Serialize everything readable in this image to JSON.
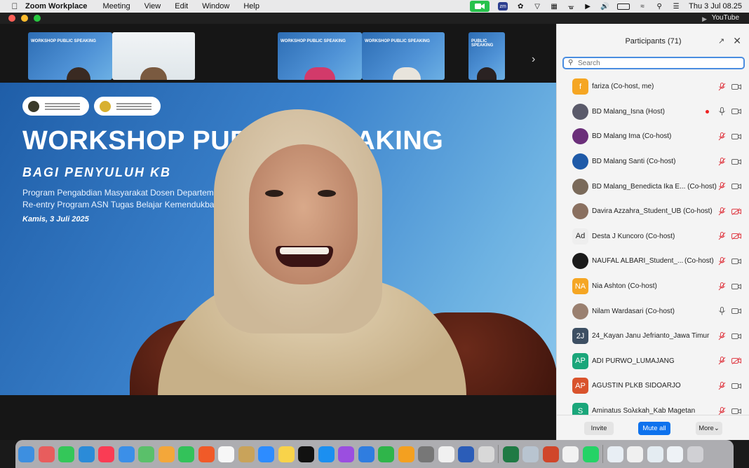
{
  "menubar": {
    "app_name": "Zoom Workplace",
    "items": [
      "Meeting",
      "View",
      "Edit",
      "Window",
      "Help"
    ],
    "zm_badge": "zm",
    "clock": "Thu 3 Jul  08.25"
  },
  "titlebar": {
    "right_label": "YouTube"
  },
  "thumbnails": {
    "slide_text": "WORKSHOP PUBLIC SPEAKING",
    "slide_text_short": "PUBLIC SPEAKING",
    "next_icon": "chevron-right-icon"
  },
  "slide": {
    "title": "WORKSHOP PUBLIC SPEAKING",
    "subtitle": "BAGI PENYULUH KB",
    "line1": "Program Pengabdian Masyarakat Dosen Departemen",
    "line2": "Re-entry Program ASN Tugas Belajar Kemendukbang",
    "date": "Kamis, 3 Juli 2025"
  },
  "participants": {
    "title": "Participants (71)",
    "search_placeholder": "Search",
    "list": [
      {
        "name": "fariza (Co-host, me)",
        "initials": "f",
        "color": "#f5a623",
        "mic": "muted",
        "cam": "on"
      },
      {
        "name": "BD Malang_Isna (Host)",
        "initials": "",
        "color": "#5a5a6a",
        "mic": "on",
        "cam": "on",
        "recording": true
      },
      {
        "name": "BD Malang Ima (Co-host)",
        "initials": "",
        "color": "#6b2f7a",
        "mic": "muted",
        "cam": "on"
      },
      {
        "name": "BD Malang Santi (Co-host)",
        "initials": "",
        "color": "#1e5aa8",
        "mic": "muted",
        "cam": "on"
      },
      {
        "name": "BD Malang_Benedicta Ika E... (Co-host)",
        "initials": "",
        "color": "#7a6a5a",
        "mic": "muted",
        "cam": "on"
      },
      {
        "name": "Davira Azzahra_Student_UB (Co-host)",
        "initials": "",
        "color": "#8a7060",
        "mic": "muted",
        "cam": "off"
      },
      {
        "name": "Desta J Kuncoro (Co-host)",
        "initials": "Ad",
        "color": "#eeeeee",
        "mic": "muted",
        "cam": "off"
      },
      {
        "name": "NAUFAL ALBARI_Student_...",
        "extra": "(Co-host)",
        "initials": "",
        "color": "#1a1a1a",
        "mic": "muted",
        "cam": "on"
      },
      {
        "name": "Nia Ashton (Co-host)",
        "initials": "NA",
        "color": "#f5a623",
        "mic": "muted",
        "cam": "on"
      },
      {
        "name": "Nilam Wardasari (Co-host)",
        "initials": "",
        "color": "#9a8070",
        "mic": "on",
        "cam": "on"
      },
      {
        "name": "24_Kayan Janu Jefrianto_Jawa Timur",
        "initials": "2J",
        "color": "#3d4f63",
        "mic": "muted",
        "cam": "on"
      },
      {
        "name": "ADI PURWO_LUMAJANG",
        "initials": "AP",
        "color": "#1aa67a",
        "mic": "muted",
        "cam": "off"
      },
      {
        "name": "AGUSTIN PLKB SIDOARJO",
        "initials": "AP",
        "color": "#d9532c",
        "mic": "muted",
        "cam": "on"
      },
      {
        "name": "Aminatus Sολεkah_Kab Magetan",
        "initials": "S",
        "color": "#1aa67a",
        "mic": "muted",
        "cam": "on"
      }
    ],
    "footer": {
      "invite": "Invite",
      "mute_all": "Mute all",
      "more": "More"
    }
  },
  "colors": {
    "accent": "#0e72ed",
    "muted_mic": "#e0424b",
    "cam_off": "#e0424b",
    "zoom_green": "#27c24c"
  }
}
